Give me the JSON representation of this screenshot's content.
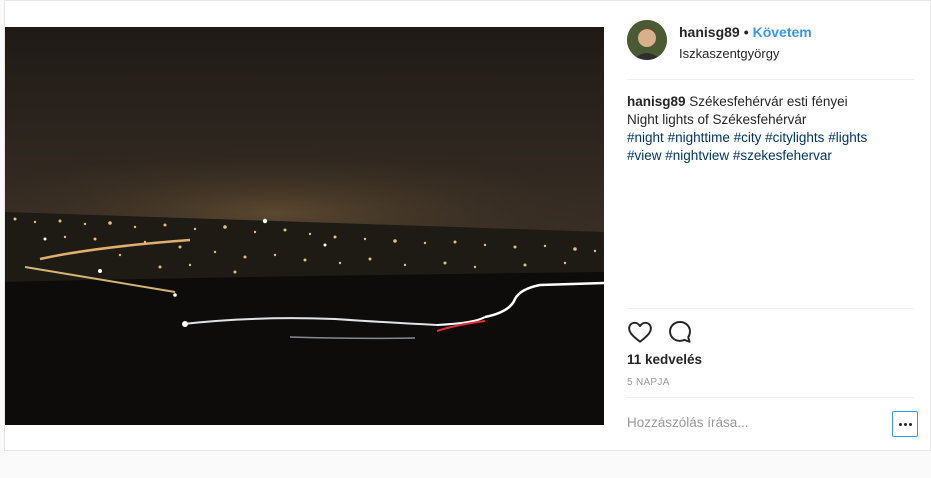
{
  "post": {
    "username": "hanisg89",
    "follow_label": "Követem",
    "location": "Iszkaszentgyörgy",
    "caption": {
      "username": "hanisg89",
      "line1": "Székesfehérvár esti fényei",
      "line2": "Night lights of Székesfehérvár",
      "hashtags_row1": [
        "#night",
        "#nighttime",
        "#city",
        "#citylights",
        "#lights"
      ],
      "hashtags_row2": [
        "#view",
        "#nightview",
        "#szekesfehervar"
      ]
    },
    "likes": "11 kedvelés",
    "time": "5 NAPJA",
    "comment_placeholder": "Hozzászólás írása...",
    "icons": {
      "like": "heart-icon",
      "comment": "comment-icon",
      "more": "more-options-icon"
    },
    "colors": {
      "link": "#3897f0",
      "hashtag": "#003569",
      "muted": "#999999"
    }
  }
}
